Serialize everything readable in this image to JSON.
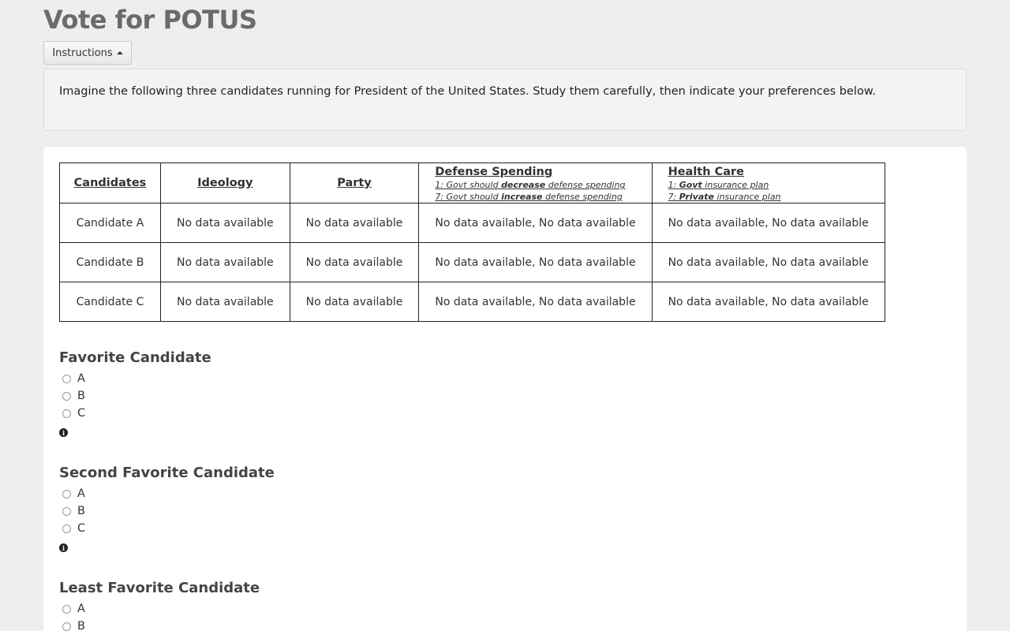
{
  "page": {
    "title": "Vote for POTUS",
    "instructions_button": "Instructions",
    "instructions_text": "Imagine the following three candidates running for President of the United States. Study them carefully, then indicate your preferences below."
  },
  "table": {
    "headers": {
      "candidates": "Candidates",
      "ideology": "Ideology",
      "party": "Party",
      "defense": {
        "title": "Defense Spending",
        "note1_a": "1: Govt should ",
        "note1_b": "decrease",
        "note1_c": " defense spending",
        "note2_a": "7: Govt should ",
        "note2_b": "increase",
        "note2_c": " defense spending"
      },
      "health": {
        "title": "Health Care",
        "note1_a": "1: ",
        "note1_b": "Govt",
        "note1_c": " insurance plan",
        "note2_a": "7: ",
        "note2_b": "Private",
        "note2_c": " insurance plan"
      }
    },
    "rows": [
      {
        "candidate": "Candidate A",
        "ideology": "No data available",
        "party": "No data available",
        "defense": "No data available, No data available",
        "health": "No data available, No data available"
      },
      {
        "candidate": "Candidate B",
        "ideology": "No data available",
        "party": "No data available",
        "defense": "No data available, No data available",
        "health": "No data available, No data available"
      },
      {
        "candidate": "Candidate C",
        "ideology": "No data available",
        "party": "No data available",
        "defense": "No data available, No data available",
        "health": "No data available, No data available"
      }
    ]
  },
  "questions": [
    {
      "title": "Favorite Candidate",
      "options": [
        "A",
        "B",
        "C"
      ]
    },
    {
      "title": "Second Favorite Candidate",
      "options": [
        "A",
        "B",
        "C"
      ]
    },
    {
      "title": "Least Favorite Candidate",
      "options": [
        "A",
        "B"
      ]
    }
  ],
  "icons": {
    "info": "info-icon",
    "caret": "caret-up-icon",
    "radio": "radio-button"
  }
}
